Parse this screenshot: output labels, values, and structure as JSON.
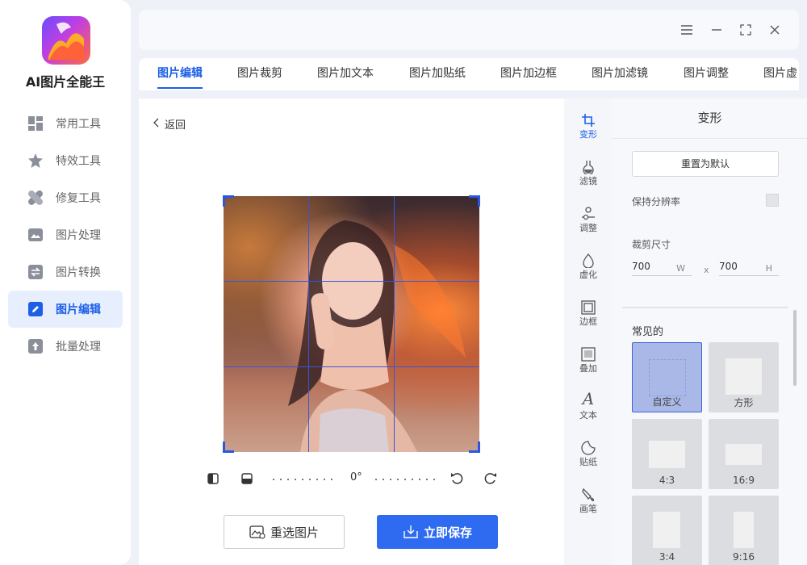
{
  "app": {
    "name": "AI图片全能王"
  },
  "sidebar": {
    "items": [
      {
        "label": "常用工具",
        "icon": "grid-icon"
      },
      {
        "label": "特效工具",
        "icon": "star-icon"
      },
      {
        "label": "修复工具",
        "icon": "bandage-icon"
      },
      {
        "label": "图片处理",
        "icon": "image-icon"
      },
      {
        "label": "图片转换",
        "icon": "convert-icon"
      },
      {
        "label": "图片编辑",
        "icon": "edit-icon",
        "active": true
      },
      {
        "label": "批量处理",
        "icon": "upload-icon"
      }
    ]
  },
  "window_controls": [
    "menu-icon",
    "minimize-icon",
    "maximize-icon",
    "close-icon"
  ],
  "tabs": [
    {
      "label": "图片编辑",
      "active": true
    },
    {
      "label": "图片裁剪"
    },
    {
      "label": "图片加文本"
    },
    {
      "label": "图片加贴纸"
    },
    {
      "label": "图片加边框"
    },
    {
      "label": "图片加滤镜"
    },
    {
      "label": "图片调整"
    },
    {
      "label": "图片虚"
    }
  ],
  "editor": {
    "back_label": "返回",
    "rotation_angle": "0°",
    "reselect_label": "重选图片",
    "save_label": "立即保存"
  },
  "tool_strip": [
    {
      "label": "变形",
      "icon": "crop-icon",
      "active": true
    },
    {
      "label": "滤镜",
      "icon": "flask-icon"
    },
    {
      "label": "调整",
      "icon": "sliders-icon"
    },
    {
      "label": "虚化",
      "icon": "drop-icon"
    },
    {
      "label": "边框",
      "icon": "frame-icon"
    },
    {
      "label": "叠加",
      "icon": "overlay-icon"
    },
    {
      "label": "文本",
      "icon": "text-icon"
    },
    {
      "label": "贴纸",
      "icon": "sticker-icon"
    },
    {
      "label": "画笔",
      "icon": "brush-icon"
    }
  ],
  "transform_panel": {
    "title": "变形",
    "reset_label": "重置为默认",
    "keep_resolution_label": "保持分辨率",
    "keep_resolution_checked": false,
    "crop_size_label": "裁剪尺寸",
    "width_value": "700",
    "width_unit": "W",
    "times": "x",
    "height_value": "700",
    "height_unit": "H",
    "common_label": "常见的",
    "presets": [
      {
        "label": "自定义",
        "selected": true
      },
      {
        "label": "方形"
      },
      {
        "label": "4:3"
      },
      {
        "label": "16:9"
      },
      {
        "label": "3:4"
      },
      {
        "label": "9:16"
      }
    ]
  },
  "colors": {
    "accent": "#2f6bf0",
    "active_nav_bg": "#e7efff",
    "crop_grid": "#3a55d8"
  }
}
